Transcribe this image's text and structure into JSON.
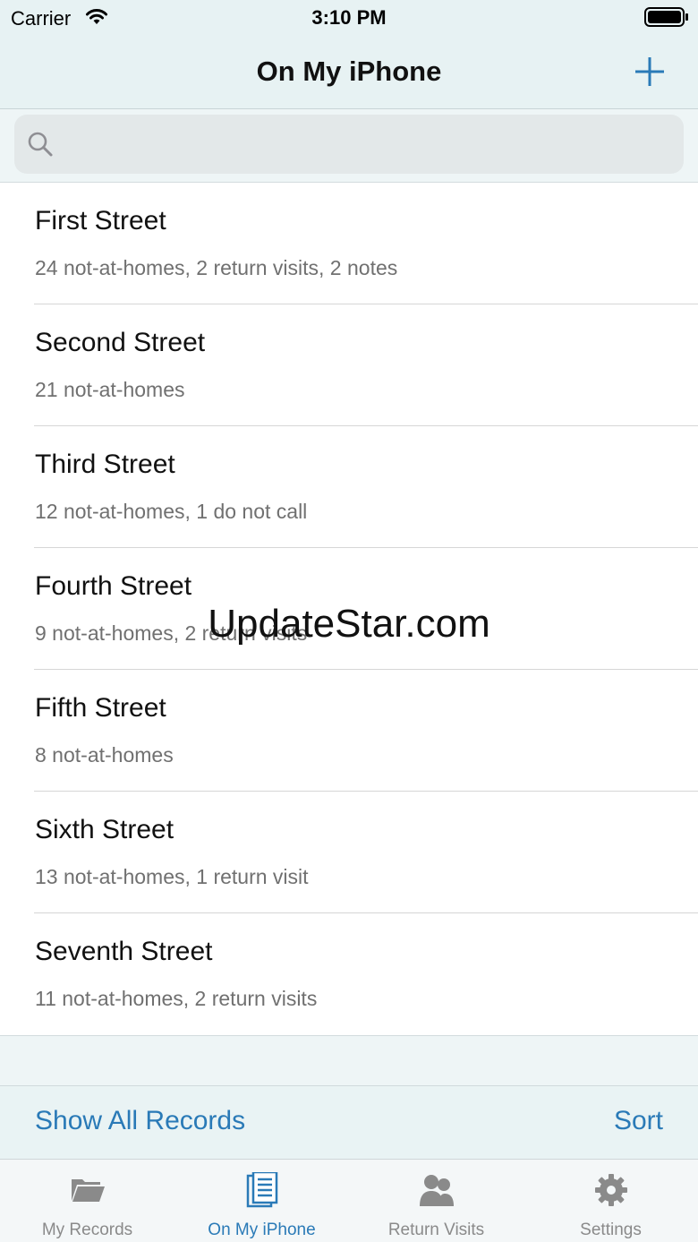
{
  "status_bar": {
    "carrier": "Carrier",
    "time": "3:10 PM"
  },
  "nav": {
    "title": "On My iPhone",
    "add_icon": "plus-icon"
  },
  "search": {
    "placeholder": "",
    "value": "",
    "icon": "search-icon"
  },
  "records": [
    {
      "title": "First Street",
      "detail": "24 not-at-homes, 2 return visits, 2 notes"
    },
    {
      "title": "Second Street",
      "detail": "21 not-at-homes"
    },
    {
      "title": "Third Street",
      "detail": "12 not-at-homes, 1 do not call"
    },
    {
      "title": "Fourth Street",
      "detail": "9 not-at-homes, 2 return visits"
    },
    {
      "title": "Fifth Street",
      "detail": "8 not-at-homes"
    },
    {
      "title": "Sixth Street",
      "detail": "13 not-at-homes, 1 return visit"
    },
    {
      "title": "Seventh Street",
      "detail": "11 not-at-homes, 2 return visits"
    }
  ],
  "watermark": "UpdateStar.com",
  "toolbar": {
    "show_all_label": "Show All Records",
    "sort_label": "Sort"
  },
  "tabs": [
    {
      "label": "My Records",
      "icon": "folder-icon",
      "active": false
    },
    {
      "label": "On My iPhone",
      "icon": "document-icon",
      "active": true
    },
    {
      "label": "Return Visits",
      "icon": "people-icon",
      "active": false
    },
    {
      "label": "Settings",
      "icon": "gear-icon",
      "active": false
    }
  ],
  "colors": {
    "accent": "#2a7ab7",
    "bar_background": "#e7f2f3",
    "inactive_tab": "#8a8a8a"
  }
}
